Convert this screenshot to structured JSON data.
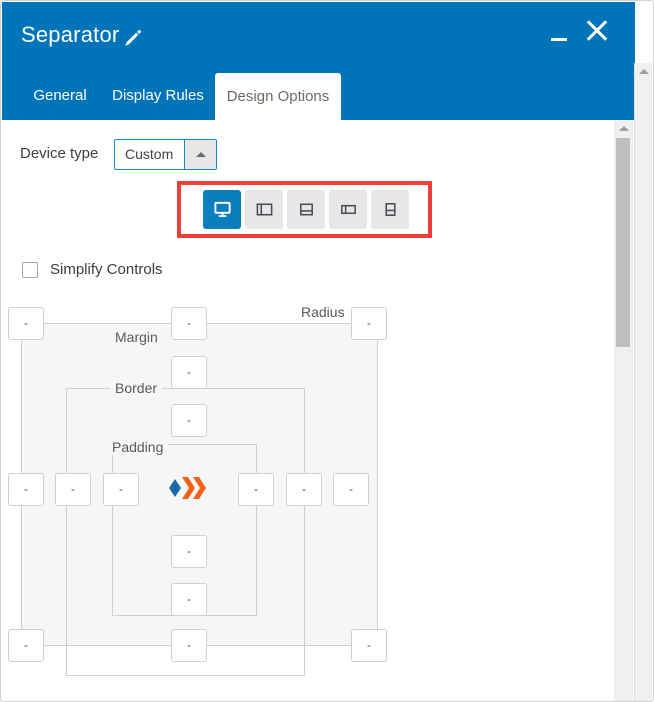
{
  "window": {
    "title": "Separator",
    "edit_icon": "pencil-icon",
    "minimize_label": "_",
    "close_label": "X"
  },
  "tabs": [
    {
      "label": "General",
      "active": false
    },
    {
      "label": "Display Rules",
      "active": false
    },
    {
      "label": "Design Options",
      "active": true
    }
  ],
  "device_type": {
    "label": "Device type",
    "value": "Custom",
    "arrow": "caret-up-icon",
    "options": [
      "Custom"
    ]
  },
  "device_buttons": [
    {
      "name": "desktop",
      "icon": "monitor-icon",
      "selected": true
    },
    {
      "name": "tablet-landscape",
      "icon": "tablet-landscape-icon",
      "selected": false
    },
    {
      "name": "tablet-portrait",
      "icon": "tablet-portrait-icon",
      "selected": false
    },
    {
      "name": "phone-landscape",
      "icon": "phone-landscape-icon",
      "selected": false
    },
    {
      "name": "phone-portrait",
      "icon": "phone-portrait-icon",
      "selected": false
    }
  ],
  "simplify_controls": {
    "label": "Simplify Controls",
    "checked": false
  },
  "box_model": {
    "labels": {
      "margin": "Margin",
      "border": "Border",
      "padding": "Padding",
      "radius": "Radius"
    },
    "placeholder": "-",
    "inputs": {
      "radius_top_left": "-",
      "margin_top": "-",
      "radius_top_right": "-",
      "border_top": "-",
      "padding_top": "-",
      "margin_left": "-",
      "border_left": "-",
      "padding_left": "-",
      "padding_right": "-",
      "border_right": "-",
      "margin_right": "-",
      "padding_bottom": "-",
      "border_bottom": "-",
      "radius_bottom_left": "-",
      "margin_bottom": "-",
      "radius_bottom_right": "-"
    },
    "logo_icon": "chevron-logo-icon"
  },
  "colors": {
    "header_blue": "#0074b8",
    "accent_blue": "#0d7ebd",
    "highlight_red": "#ef3e36",
    "logo_blue": "#1769a8",
    "logo_orange": "#f4601a"
  },
  "scrollbars": {
    "outer": {
      "arrow": "scroll-up-arrow"
    },
    "inner": {
      "arrow": "scroll-up-arrow"
    }
  }
}
